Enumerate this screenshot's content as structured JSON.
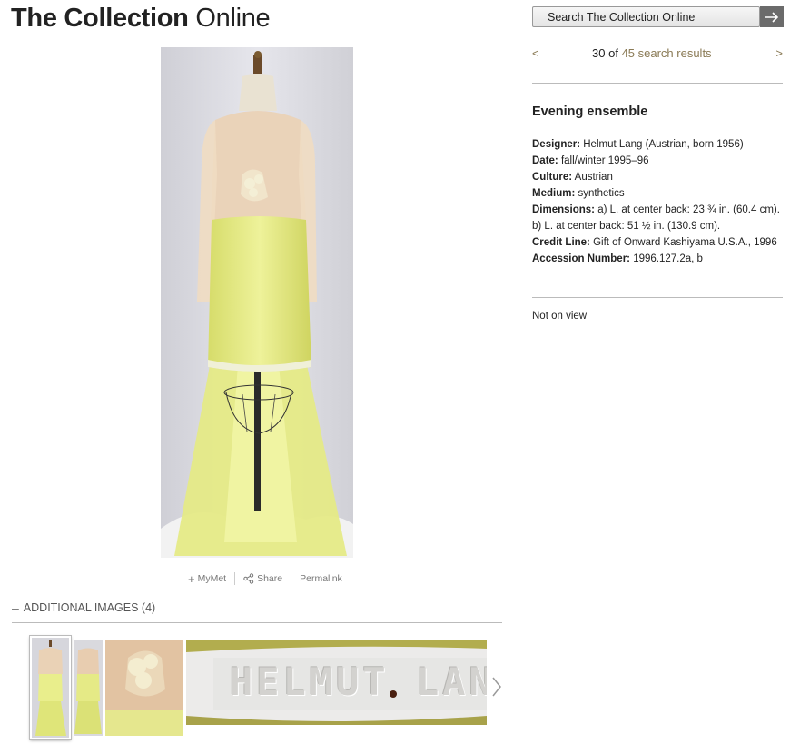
{
  "header": {
    "title_bold": "The Collection",
    "title_light": "Online"
  },
  "search": {
    "label": "Search The Collection Online",
    "go_icon": "arrow-right-icon"
  },
  "pager": {
    "prev": "<",
    "next": ">",
    "current": "30",
    "of": "of",
    "results": "45 search results"
  },
  "object": {
    "title": "Evening ensemble",
    "fields": [
      {
        "label": "Designer:",
        "value": "Helmut Lang (Austrian, born 1956)"
      },
      {
        "label": "Date:",
        "value": "fall/winter 1995–96"
      },
      {
        "label": "Culture:",
        "value": "Austrian"
      },
      {
        "label": "Medium:",
        "value": "synthetics"
      },
      {
        "label": "Dimensions:",
        "value": "a) L. at center back: 23 ¾ in. (60.4 cm). b) L. at center back: 51 ½ in. (130.9 cm)."
      },
      {
        "label": "Credit Line:",
        "value": "Gift of Onward Kashiyama U.S.A., 1996"
      },
      {
        "label": "Accession Number:",
        "value": "1996.127.2a, b"
      }
    ],
    "on_view": "Not on view"
  },
  "tools": {
    "mymet": "MyMet",
    "share": "Share",
    "permalink": "Permalink"
  },
  "additional_images": {
    "heading": "ADDITIONAL IMAGES (4)",
    "label_text": "HELMUT LAN"
  },
  "colors": {
    "accent": "#8a7a55",
    "dress_yellow": "#e9ee8c",
    "blouse": "#e8cfb4"
  }
}
